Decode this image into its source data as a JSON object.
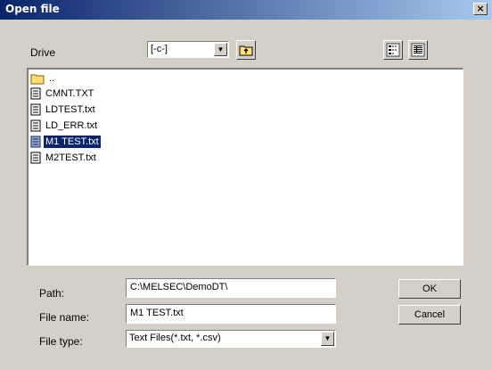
{
  "window": {
    "title": "Open file",
    "close_glyph": "×"
  },
  "drive": {
    "label": "Drive",
    "value": "[-c-]"
  },
  "toolbar": {
    "up_folder_icon": "up-folder-icon",
    "list_view_icon": "list-view-icon",
    "details_view_icon": "details-view-icon"
  },
  "files": [
    {
      "name": "..",
      "type": "folder",
      "selected": false
    },
    {
      "name": "CMNT.TXT",
      "type": "file",
      "selected": false
    },
    {
      "name": "LDTEST.txt",
      "type": "file",
      "selected": false
    },
    {
      "name": "LD_ERR.txt",
      "type": "file",
      "selected": false
    },
    {
      "name": "M1 TEST.txt",
      "type": "file",
      "selected": true
    },
    {
      "name": "M2TEST.txt",
      "type": "file",
      "selected": false
    }
  ],
  "path": {
    "label": "Path:",
    "value": "C:\\MELSEC\\DemoDT\\"
  },
  "file_name": {
    "label": "File name:",
    "value": "M1 TEST.txt"
  },
  "file_type": {
    "label": "File type:",
    "value": "Text Files(*.txt, *.csv)"
  },
  "buttons": {
    "ok": "OK",
    "cancel": "Cancel"
  },
  "colors": {
    "title_start": "#0a246a",
    "title_end": "#a6caf0",
    "selection": "#0a246a",
    "face": "#d4d0c8"
  }
}
